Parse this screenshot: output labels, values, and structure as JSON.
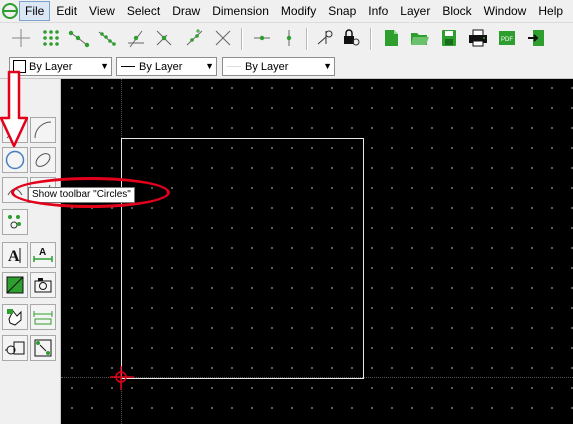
{
  "menubar": {
    "items": [
      "File",
      "Edit",
      "View",
      "Select",
      "Draw",
      "Dimension",
      "Modify",
      "Snap",
      "Info",
      "Layer",
      "Block",
      "Window",
      "Help"
    ]
  },
  "toolbar1": {
    "icons": [
      "snap-free-icon",
      "snap-grid-icon",
      "snap-endpoint-icon",
      "snap-on-entity-icon",
      "snap-center-icon",
      "snap-middle-icon",
      "snap-distance-icon",
      "snap-intersection-icon",
      "restrict-horizontal-icon",
      "restrict-vertical-icon",
      "relative-zero-icon",
      "lock-relative-zero-icon",
      "new-file-icon",
      "open-file-icon",
      "save-file-icon",
      "print-icon",
      "export-pdf-icon",
      "exit-icon"
    ],
    "pdf_label": "PDF"
  },
  "toolbar2": {
    "color_combo": "By Layer",
    "linetype_combo": "By Layer",
    "width_combo": "By Layer"
  },
  "left_toolbar": {
    "text_label": "A",
    "dim_label": "A"
  },
  "tooltip": {
    "text": "Show toolbar \"Circles\""
  },
  "colors": {
    "canvas": "#000000",
    "toolbar": "#f0f0f0",
    "highlight": "#e3001b",
    "icon_green": "#2e9e2e"
  }
}
